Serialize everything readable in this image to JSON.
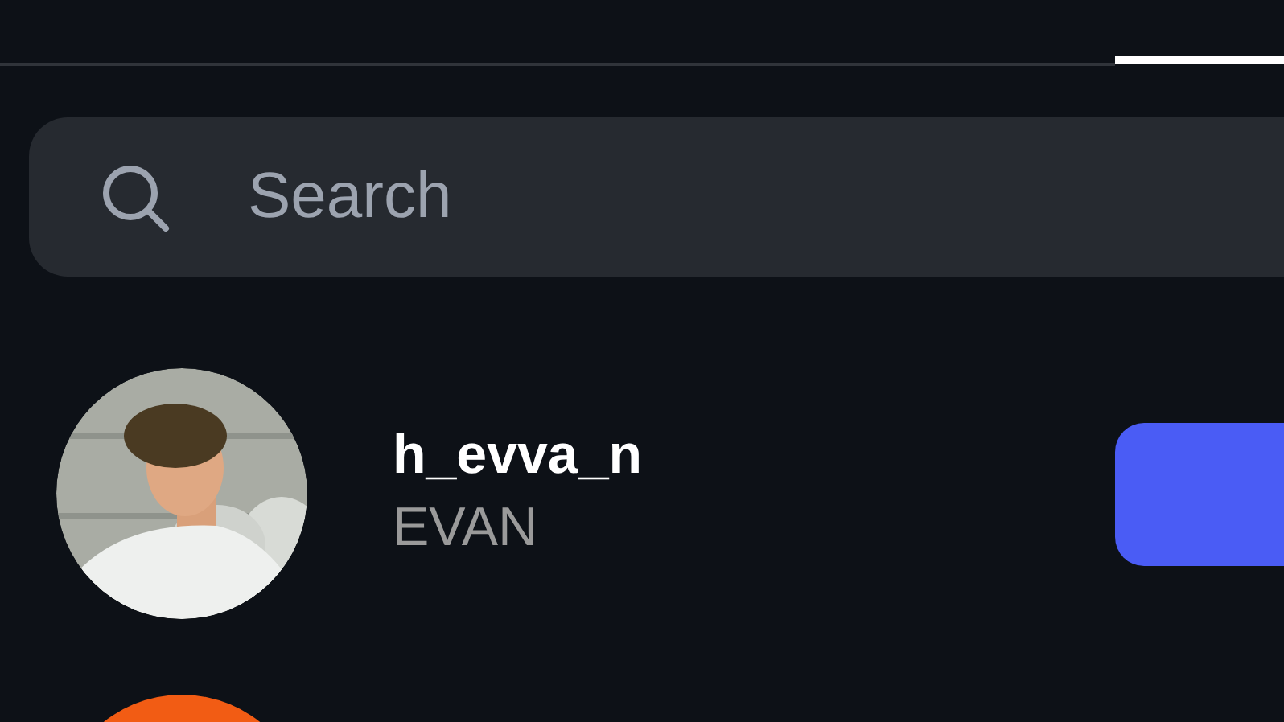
{
  "tabs": [
    {
      "selected": false
    },
    {
      "selected": true
    }
  ],
  "search": {
    "placeholder": "Search"
  },
  "users": [
    {
      "username": "h_evva_n",
      "name": "EVAN",
      "kind": "picture"
    },
    {
      "kind": "plain",
      "color": "#f25c14"
    }
  ]
}
